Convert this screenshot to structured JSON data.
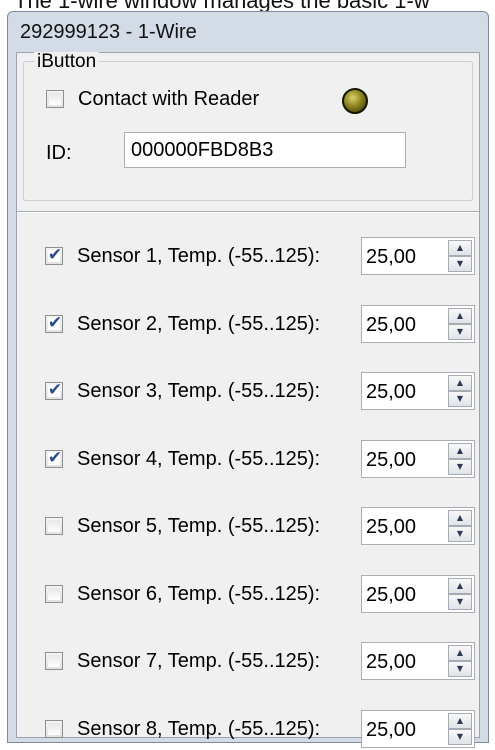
{
  "caption": "The 1-wire window manages the basic 1-w",
  "window": {
    "title": "292999123 - 1-Wire"
  },
  "ibutton": {
    "group_title": "iButton",
    "contact_label": "Contact with Reader",
    "contact_checked": false,
    "id_label": "ID:",
    "id_value": "000000FBD8B3",
    "led_color": "#8c8420"
  },
  "sensors": [
    {
      "label": "Sensor 1, Temp. (-55..125):",
      "checked": true,
      "value": "25,00"
    },
    {
      "label": "Sensor 2, Temp. (-55..125):",
      "checked": true,
      "value": "25,00"
    },
    {
      "label": "Sensor 3, Temp. (-55..125):",
      "checked": true,
      "value": "25,00"
    },
    {
      "label": "Sensor 4, Temp. (-55..125):",
      "checked": true,
      "value": "25,00"
    },
    {
      "label": "Sensor 5, Temp. (-55..125):",
      "checked": false,
      "value": "25,00"
    },
    {
      "label": "Sensor 6, Temp. (-55..125):",
      "checked": false,
      "value": "25,00"
    },
    {
      "label": "Sensor 7, Temp. (-55..125):",
      "checked": false,
      "value": "25,00"
    },
    {
      "label": "Sensor 8, Temp. (-55..125):",
      "checked": false,
      "value": "25,00"
    }
  ],
  "icons": {
    "check": "check-icon",
    "spin_up": "arrow-up-icon",
    "spin_down": "arrow-down-icon",
    "led": "indicator-led-icon"
  }
}
